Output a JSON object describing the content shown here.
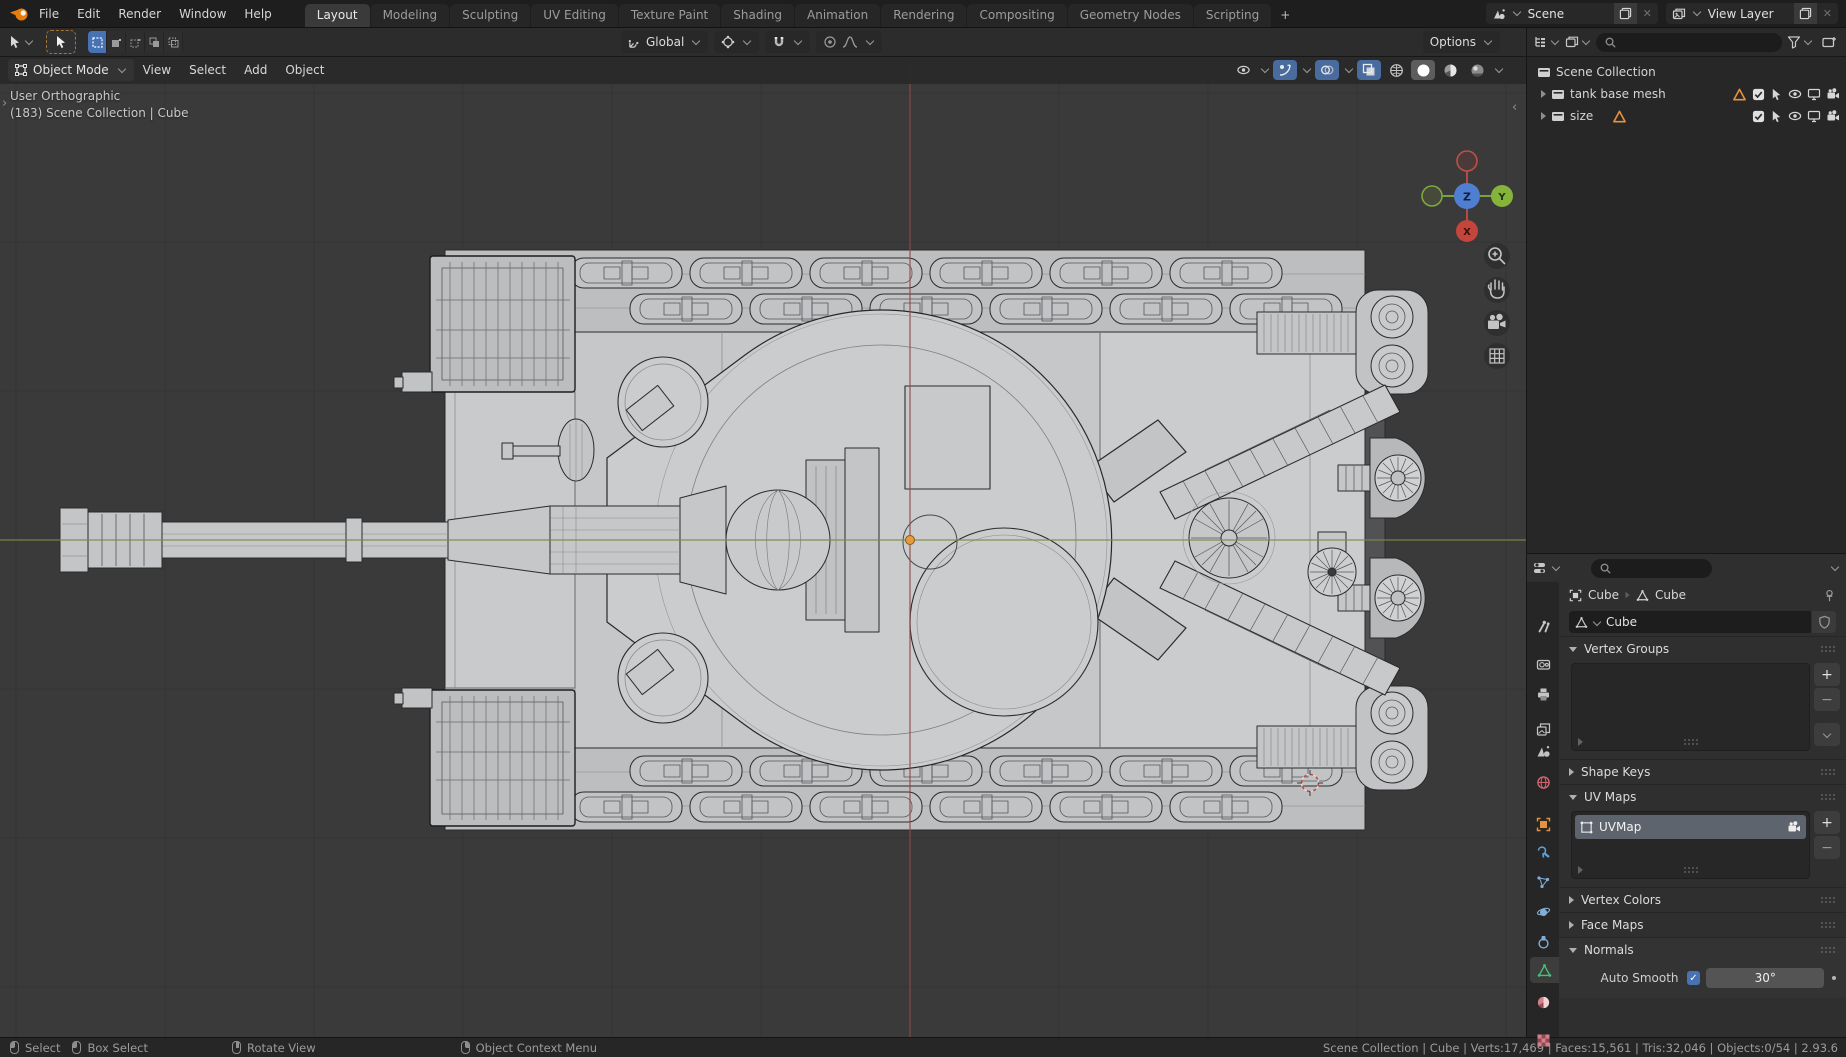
{
  "topbar": {
    "menus": [
      "File",
      "Edit",
      "Render",
      "Window",
      "Help"
    ],
    "tabs": [
      "Layout",
      "Modeling",
      "Sculpting",
      "UV Editing",
      "Texture Paint",
      "Shading",
      "Animation",
      "Rendering",
      "Compositing",
      "Geometry Nodes",
      "Scripting"
    ],
    "add_tab": "+",
    "scene_label": "Scene",
    "view_layer_label": "View Layer"
  },
  "tool_settings": {
    "orientation": "Global",
    "options": "Options"
  },
  "viewport": {
    "mode": "Object Mode",
    "menus": [
      "View",
      "Select",
      "Add",
      "Object"
    ],
    "view_label": "User Orthographic",
    "context_label": "(183) Scene Collection | Cube",
    "gizmo": {
      "x": "X",
      "y": "Y",
      "z": "Z"
    }
  },
  "outliner": {
    "root": "Scene Collection",
    "rows": [
      {
        "label": "tank base mesh"
      },
      {
        "label": "size"
      }
    ]
  },
  "properties": {
    "breadcrumb": {
      "object": "Cube",
      "data": "Cube"
    },
    "name": "Cube",
    "sections": {
      "vertex_groups": "Vertex Groups",
      "shape_keys": "Shape Keys",
      "uv_maps": "UV Maps",
      "vertex_colors": "Vertex Colors",
      "face_maps": "Face Maps",
      "normals": "Normals"
    },
    "uv_map_item": "UVMap",
    "list_add": "+",
    "list_remove": "−",
    "auto_smooth": {
      "label": "Auto Smooth",
      "value": "30°"
    }
  },
  "statusbar": {
    "hints": [
      "Select",
      "Box Select",
      "Rotate View",
      "Object Context Menu"
    ],
    "stats": "Scene Collection | Cube | Verts:17,469 | Faces:15,561 | Tris:32,046 | Objects:0/54 | 2.93.6"
  },
  "colors": {
    "accent_blue": "#4772b3",
    "object_orange": "#e8923e",
    "axis_green": "#7b8a45",
    "axis_red": "#8e4a4a"
  }
}
